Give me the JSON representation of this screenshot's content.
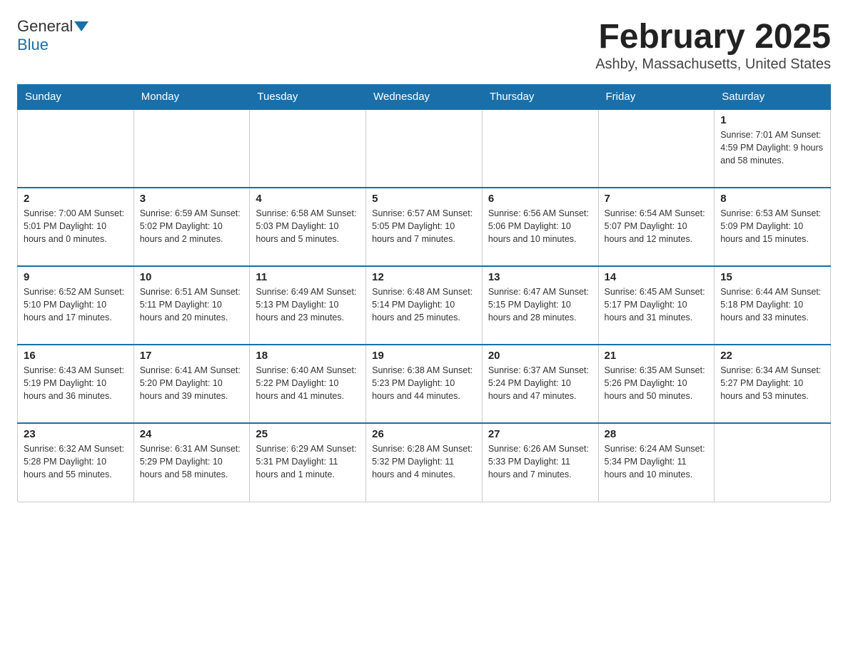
{
  "logo": {
    "general": "General",
    "blue": "Blue"
  },
  "header": {
    "title": "February 2025",
    "location": "Ashby, Massachusetts, United States"
  },
  "weekdays": [
    "Sunday",
    "Monday",
    "Tuesday",
    "Wednesday",
    "Thursday",
    "Friday",
    "Saturday"
  ],
  "weeks": [
    [
      {
        "day": "",
        "info": ""
      },
      {
        "day": "",
        "info": ""
      },
      {
        "day": "",
        "info": ""
      },
      {
        "day": "",
        "info": ""
      },
      {
        "day": "",
        "info": ""
      },
      {
        "day": "",
        "info": ""
      },
      {
        "day": "1",
        "info": "Sunrise: 7:01 AM\nSunset: 4:59 PM\nDaylight: 9 hours and 58 minutes."
      }
    ],
    [
      {
        "day": "2",
        "info": "Sunrise: 7:00 AM\nSunset: 5:01 PM\nDaylight: 10 hours and 0 minutes."
      },
      {
        "day": "3",
        "info": "Sunrise: 6:59 AM\nSunset: 5:02 PM\nDaylight: 10 hours and 2 minutes."
      },
      {
        "day": "4",
        "info": "Sunrise: 6:58 AM\nSunset: 5:03 PM\nDaylight: 10 hours and 5 minutes."
      },
      {
        "day": "5",
        "info": "Sunrise: 6:57 AM\nSunset: 5:05 PM\nDaylight: 10 hours and 7 minutes."
      },
      {
        "day": "6",
        "info": "Sunrise: 6:56 AM\nSunset: 5:06 PM\nDaylight: 10 hours and 10 minutes."
      },
      {
        "day": "7",
        "info": "Sunrise: 6:54 AM\nSunset: 5:07 PM\nDaylight: 10 hours and 12 minutes."
      },
      {
        "day": "8",
        "info": "Sunrise: 6:53 AM\nSunset: 5:09 PM\nDaylight: 10 hours and 15 minutes."
      }
    ],
    [
      {
        "day": "9",
        "info": "Sunrise: 6:52 AM\nSunset: 5:10 PM\nDaylight: 10 hours and 17 minutes."
      },
      {
        "day": "10",
        "info": "Sunrise: 6:51 AM\nSunset: 5:11 PM\nDaylight: 10 hours and 20 minutes."
      },
      {
        "day": "11",
        "info": "Sunrise: 6:49 AM\nSunset: 5:13 PM\nDaylight: 10 hours and 23 minutes."
      },
      {
        "day": "12",
        "info": "Sunrise: 6:48 AM\nSunset: 5:14 PM\nDaylight: 10 hours and 25 minutes."
      },
      {
        "day": "13",
        "info": "Sunrise: 6:47 AM\nSunset: 5:15 PM\nDaylight: 10 hours and 28 minutes."
      },
      {
        "day": "14",
        "info": "Sunrise: 6:45 AM\nSunset: 5:17 PM\nDaylight: 10 hours and 31 minutes."
      },
      {
        "day": "15",
        "info": "Sunrise: 6:44 AM\nSunset: 5:18 PM\nDaylight: 10 hours and 33 minutes."
      }
    ],
    [
      {
        "day": "16",
        "info": "Sunrise: 6:43 AM\nSunset: 5:19 PM\nDaylight: 10 hours and 36 minutes."
      },
      {
        "day": "17",
        "info": "Sunrise: 6:41 AM\nSunset: 5:20 PM\nDaylight: 10 hours and 39 minutes."
      },
      {
        "day": "18",
        "info": "Sunrise: 6:40 AM\nSunset: 5:22 PM\nDaylight: 10 hours and 41 minutes."
      },
      {
        "day": "19",
        "info": "Sunrise: 6:38 AM\nSunset: 5:23 PM\nDaylight: 10 hours and 44 minutes."
      },
      {
        "day": "20",
        "info": "Sunrise: 6:37 AM\nSunset: 5:24 PM\nDaylight: 10 hours and 47 minutes."
      },
      {
        "day": "21",
        "info": "Sunrise: 6:35 AM\nSunset: 5:26 PM\nDaylight: 10 hours and 50 minutes."
      },
      {
        "day": "22",
        "info": "Sunrise: 6:34 AM\nSunset: 5:27 PM\nDaylight: 10 hours and 53 minutes."
      }
    ],
    [
      {
        "day": "23",
        "info": "Sunrise: 6:32 AM\nSunset: 5:28 PM\nDaylight: 10 hours and 55 minutes."
      },
      {
        "day": "24",
        "info": "Sunrise: 6:31 AM\nSunset: 5:29 PM\nDaylight: 10 hours and 58 minutes."
      },
      {
        "day": "25",
        "info": "Sunrise: 6:29 AM\nSunset: 5:31 PM\nDaylight: 11 hours and 1 minute."
      },
      {
        "day": "26",
        "info": "Sunrise: 6:28 AM\nSunset: 5:32 PM\nDaylight: 11 hours and 4 minutes."
      },
      {
        "day": "27",
        "info": "Sunrise: 6:26 AM\nSunset: 5:33 PM\nDaylight: 11 hours and 7 minutes."
      },
      {
        "day": "28",
        "info": "Sunrise: 6:24 AM\nSunset: 5:34 PM\nDaylight: 11 hours and 10 minutes."
      },
      {
        "day": "",
        "info": ""
      }
    ]
  ]
}
